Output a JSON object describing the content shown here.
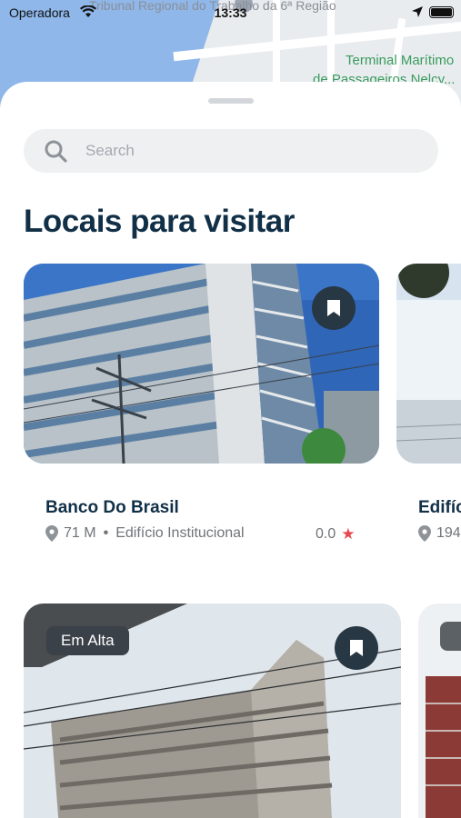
{
  "status_bar": {
    "carrier": "Operadora",
    "time": "13:33"
  },
  "map": {
    "label_top": "Tribunal Regional do Trabalho da 6ª Região",
    "label_terminal_1": "Terminal Marítimo",
    "label_terminal_2": "de Passageiros Nelcy..."
  },
  "search": {
    "placeholder": "Search",
    "value": ""
  },
  "section_title": "Locais para visitar",
  "cards": [
    {
      "name": "Banco Do Brasil",
      "distance": "71 M",
      "category": "Edifício Institucional",
      "rating": "0.0",
      "badge": ""
    },
    {
      "name": "Edifíc",
      "distance": "194",
      "category": "",
      "rating": "",
      "badge": ""
    },
    {
      "name": "",
      "distance": "",
      "category": "",
      "rating": "",
      "badge": "Em Alta"
    }
  ],
  "colors": {
    "title": "#113047",
    "accent_dark": "#273744",
    "star": "#e5484d"
  },
  "icons": [
    "wifi-icon",
    "location-arrow-icon",
    "battery-icon",
    "search-icon",
    "bookmark-icon",
    "pin-icon",
    "star-icon"
  ]
}
